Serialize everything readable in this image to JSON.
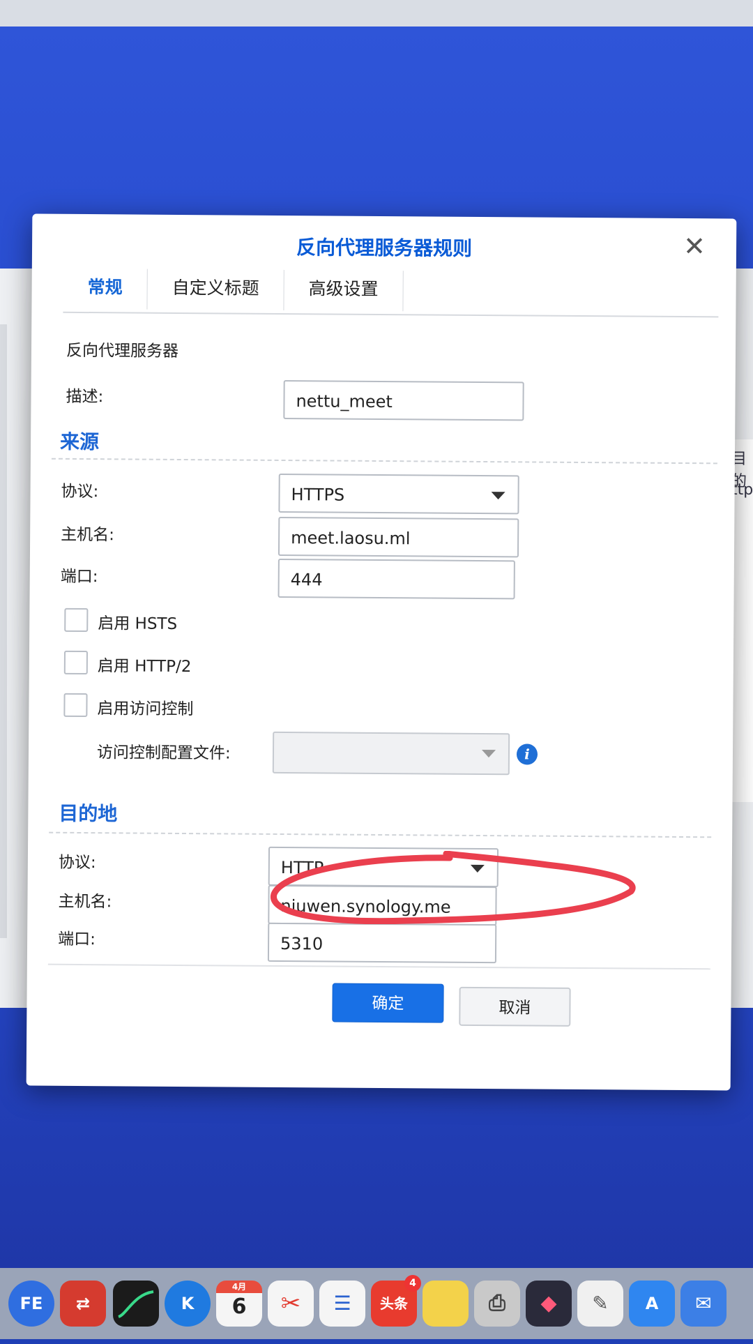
{
  "dialog": {
    "title": "反向代理服务器规则",
    "tabs": [
      {
        "label": "常规"
      },
      {
        "label": "自定义标题"
      },
      {
        "label": "高级设置"
      }
    ],
    "subtitle": "反向代理服务器",
    "description_label": "描述:",
    "description_value": "nettu_meet"
  },
  "source": {
    "heading": "来源",
    "protocol_label": "协议:",
    "protocol_value": "HTTPS",
    "hostname_label": "主机名:",
    "hostname_value": "meet.laosu.ml",
    "port_label": "端口:",
    "port_value": "444",
    "checkboxes": [
      {
        "label": "启用 HSTS",
        "checked": false
      },
      {
        "label": "启用 HTTP/2",
        "checked": false
      },
      {
        "label": "启用访问控制",
        "checked": false
      }
    ],
    "access_profile_label": "访问控制配置文件:",
    "access_profile_value": ""
  },
  "destination": {
    "heading": "目的地",
    "protocol_label": "协议:",
    "protocol_value": "HTTP",
    "hostname_label": "主机名:",
    "hostname_value": "niuwen.synology.me",
    "port_label": "端口:",
    "port_value": "5310"
  },
  "buttons": {
    "ok": "确定",
    "cancel": "取消"
  },
  "background": {
    "text1": "目的",
    "text2": "ttp"
  },
  "dock": {
    "icons": [
      {
        "name": "fe-app-icon",
        "text": "FE",
        "color": "#2f6ee0"
      },
      {
        "name": "remote-desktop-icon",
        "text": "",
        "color": "#d53b2f"
      },
      {
        "name": "terminal-chart-icon",
        "text": "",
        "color": "#1b1b1b"
      },
      {
        "name": "k-app-icon",
        "text": "K",
        "color": "#1f7ae0"
      },
      {
        "name": "calendar-icon",
        "text": "6",
        "color": "#f5f5f5",
        "month": "4月"
      },
      {
        "name": "scissors-icon",
        "text": "✂",
        "color": "#f5f5f5"
      },
      {
        "name": "reminders-icon",
        "text": "",
        "color": "#f5f5f5"
      },
      {
        "name": "toutiao-icon",
        "text": "头条",
        "color": "#e83b2e",
        "badge": "4"
      },
      {
        "name": "notes-icon",
        "text": "",
        "color": "#f3d24a"
      },
      {
        "name": "printer-icon",
        "text": "",
        "color": "#c9c9c9"
      },
      {
        "name": "shortcuts-icon",
        "text": "",
        "color": "#2a2a3a"
      },
      {
        "name": "textedit-icon",
        "text": "",
        "color": "#f0f0f0"
      },
      {
        "name": "app-store-icon",
        "text": "A",
        "color": "#2f86f0"
      },
      {
        "name": "mail-icon",
        "text": "",
        "color": "#3c7fe6"
      }
    ]
  }
}
